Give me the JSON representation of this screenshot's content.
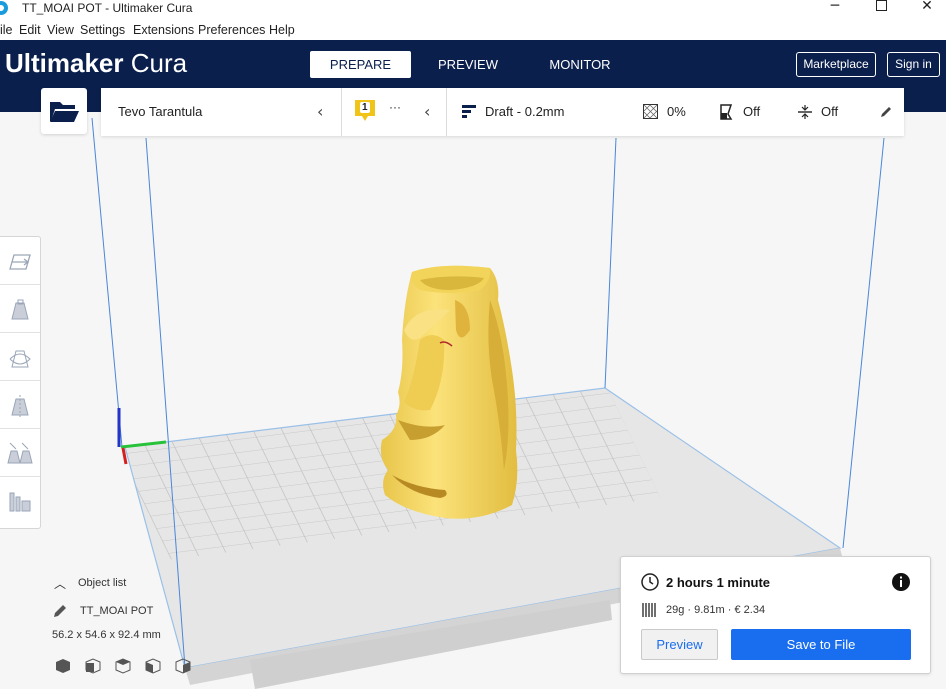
{
  "window": {
    "title": "TT_MOAI POT - Ultimaker Cura",
    "minimize": "─",
    "close": "✕"
  },
  "menu": [
    "ile",
    "Edit",
    "View",
    "Settings",
    "Extensions",
    "Preferences",
    "Help"
  ],
  "header": {
    "brand_bold": "Ultimaker",
    "brand_light": "Cura",
    "tabs": [
      "PREPARE",
      "PREVIEW",
      "MONITOR"
    ],
    "active_tab": "PREPARE",
    "marketplace": "Marketplace",
    "sign_in": "Sign in"
  },
  "toolbar": {
    "printer": "Tevo Tarantula",
    "extruder_badge": "1",
    "extruder_more": "···",
    "profile": "Draft - 0.2mm",
    "infill": "0%",
    "support": "Off",
    "adhesion": "Off"
  },
  "object_list": {
    "label": "Object list",
    "object_name": "TT_MOAI POT",
    "dimensions": "56.2 x 54.6 x 92.4 mm"
  },
  "print_panel": {
    "time": "2 hours 1 minute",
    "meta": "29g · 9.81m · € 2.34",
    "preview_button": "Preview",
    "save_button": "Save to File"
  },
  "colors": {
    "header_bg": "#0b1f4d",
    "accent": "#196ef0",
    "model": "#f6dc6c"
  },
  "icons": {
    "folder": "folder-open-icon",
    "clock": "clock-icon",
    "info": "info-icon",
    "edit": "pencil-icon"
  }
}
